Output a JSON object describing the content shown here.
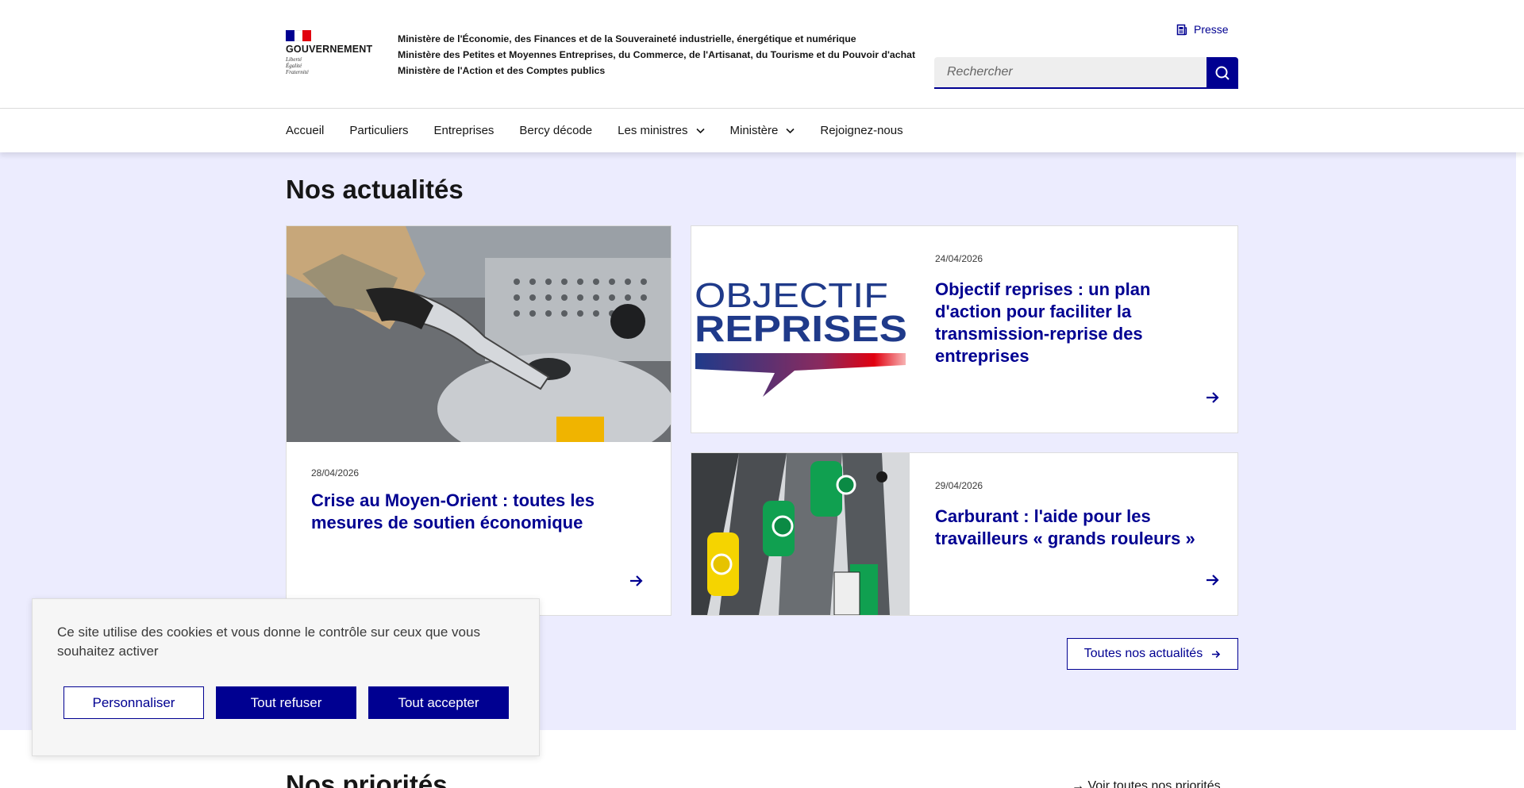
{
  "header": {
    "gov_name": "GOUVERNEMENT",
    "motto": [
      "Liberté",
      "Égalité",
      "Fraternité"
    ],
    "ministries": [
      "Ministère de l'Économie, des Finances et de la Souveraineté industrielle, énergétique et numérique",
      "Ministère des Petites et Moyennes Entreprises, du Commerce, de l'Artisanat, du Tourisme et du Pouvoir d'achat",
      "Ministère de l'Action et des Comptes publics"
    ],
    "press_label": "Presse",
    "search_placeholder": "Rechercher"
  },
  "nav": {
    "items": [
      "Accueil",
      "Particuliers",
      "Entreprises",
      "Bercy décode",
      "Les ministres",
      "Ministère",
      "Rejoignez-nous"
    ]
  },
  "news": {
    "title": "Nos actualités",
    "cards": [
      {
        "date": "28/04/2026",
        "title": "Crise au Moyen-Orient : toutes les mesures de soutien économique"
      },
      {
        "date": "24/04/2026",
        "title": "Objectif reprises : un plan d'action pour faciliter la transmission-reprise des entreprises",
        "image_text": [
          "OBJECTIF",
          "REPRISES"
        ]
      },
      {
        "date": "29/04/2026",
        "title": "Carburant : l'aide pour les travailleurs « grands rouleurs »"
      }
    ],
    "all_news_label": "Toutes nos actualités"
  },
  "priorities": {
    "title": "Nos priorités",
    "link_label": "Voir toutes nos priorités"
  },
  "cookie": {
    "text": "Ce site utilise des cookies et vous donne le contrôle sur ceux que vous souhaitez activer",
    "customize_label": "Personnaliser",
    "refuse_label": "Tout refuser",
    "accept_label": "Tout accepter"
  },
  "colors": {
    "primary": "#000091",
    "news_bg": "#ececfe",
    "flag_red": "#e1000f"
  }
}
